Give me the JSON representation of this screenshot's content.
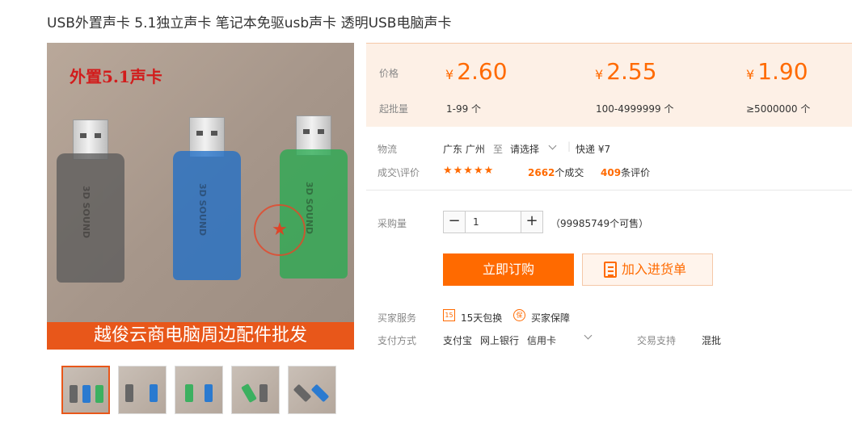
{
  "product": {
    "title": "USB外置声卡 5.1独立声卡 笔记本免驱usb声卡 透明USB电脑声卡",
    "image_overlay_text": "外置5.1声卡",
    "image_banner_text": "越俊云商电脑周边配件批发",
    "usb_label": "3D SOUND"
  },
  "pricing": {
    "price_label": "价格",
    "qty_label": "起批量",
    "currency": "¥",
    "tiers": [
      {
        "price": "2.60",
        "qty": "1-99 个"
      },
      {
        "price": "2.55",
        "qty": "100-4999999 个"
      },
      {
        "price": "1.90",
        "qty": "≥5000000 个"
      }
    ]
  },
  "logistics": {
    "label": "物流",
    "from": "广东 广州",
    "to_word": "至",
    "destination": "请选择",
    "shipping": "快递 ¥7"
  },
  "deals": {
    "label": "成交\\评价",
    "stars": "★★★★★",
    "deals_count": "2662",
    "deals_suffix": "个成交",
    "reviews_count": "409",
    "reviews_suffix": "条评价"
  },
  "purchase": {
    "label": "采购量",
    "minus": "−",
    "plus": "+",
    "quantity": "1",
    "available": "（99985749个可售）",
    "buy_now": "立即订购",
    "add_cart": "加入进货单"
  },
  "services": {
    "label": "买家服务",
    "items": [
      {
        "icon": "15",
        "text": "15天包换"
      },
      {
        "icon": "保",
        "text": "买家保障"
      }
    ]
  },
  "payment": {
    "label": "支付方式",
    "methods": [
      "支付宝",
      "网上银行",
      "信用卡"
    ],
    "trade_label": "交易支持",
    "trade_value": "混批"
  },
  "colors": {
    "accent": "#ff6a00",
    "panel_bg": "#fdf0e6"
  }
}
